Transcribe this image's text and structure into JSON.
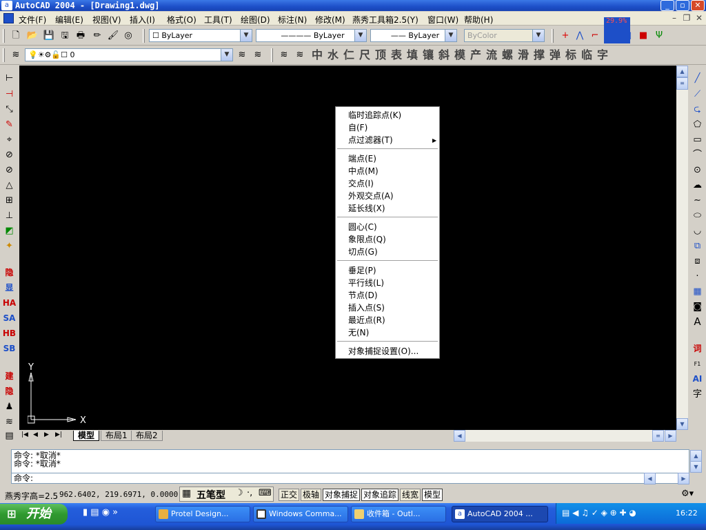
{
  "window": {
    "title": "AutoCAD 2004 - [Drawing1.dwg]"
  },
  "menubar": {
    "items": [
      "文件(F)",
      "编辑(E)",
      "视图(V)",
      "插入(I)",
      "格式(O)",
      "工具(T)",
      "绘图(D)",
      "标注(N)",
      "修改(M)",
      "燕秀工具箱2.5(Y)",
      "窗口(W)",
      "帮助(H)"
    ]
  },
  "properties": {
    "color": "ByLayer",
    "linetype": "ByLayer",
    "lineweight": "ByLayer",
    "plotstyle": "ByColor"
  },
  "layer": {
    "current": "0"
  },
  "zoom_indicator": "29.9%",
  "yanxiu_toolbar": [
    "中",
    "水",
    "仁",
    "尺",
    "顶",
    "表",
    "填",
    "镶",
    "斜",
    "模",
    "产",
    "流",
    "螺",
    "滑",
    "撑",
    "弹",
    "标",
    "临",
    "字"
  ],
  "left_toolbar_text": [
    "隐",
    "显",
    "HA",
    "SA",
    "HB",
    "SB",
    "建",
    "隐"
  ],
  "right_toolbar_text": [
    "词",
    "A"
  ],
  "ucs": {
    "y": "Y",
    "x": "X"
  },
  "context_menu": {
    "items": [
      {
        "label": "临时追踪点(K)"
      },
      {
        "label": "自(F)"
      },
      {
        "label": "点过滤器(T)",
        "submenu": true
      },
      {
        "label": "端点(E)"
      },
      {
        "label": "中点(M)"
      },
      {
        "label": "交点(I)"
      },
      {
        "label": "外观交点(A)"
      },
      {
        "label": "延长线(X)"
      },
      {
        "label": "圆心(C)"
      },
      {
        "label": "象限点(Q)"
      },
      {
        "label": "切点(G)"
      },
      {
        "label": "垂足(P)"
      },
      {
        "label": "平行线(L)"
      },
      {
        "label": "节点(D)"
      },
      {
        "label": "插入点(S)"
      },
      {
        "label": "最近点(R)"
      },
      {
        "label": "无(N)"
      },
      {
        "label": "对象捕捉设置(O)..."
      }
    ]
  },
  "layout_tabs": [
    "模型",
    "布局1",
    "布局2"
  ],
  "command": {
    "history": [
      "命令: *取消*",
      "命令: *取消*"
    ],
    "prompt": "命令:"
  },
  "status": {
    "font_height": "燕秀字高=2.5",
    "coords": "962.6402,  219.6971, 0.0000",
    "ime": "五笔型",
    "toggles": [
      {
        "label": "正交",
        "on": false
      },
      {
        "label": "极轴",
        "on": false
      },
      {
        "label": "对象捕捉",
        "on": true
      },
      {
        "label": "对象追踪",
        "on": true
      },
      {
        "label": "线宽",
        "on": false
      },
      {
        "label": "模型",
        "on": true
      }
    ]
  },
  "taskbar": {
    "start": "开始",
    "tasks": [
      "Protel Design...",
      "Windows Comma...",
      "收件箱 - Outl...",
      "AutoCAD 2004 ..."
    ],
    "clock": "16:22"
  }
}
